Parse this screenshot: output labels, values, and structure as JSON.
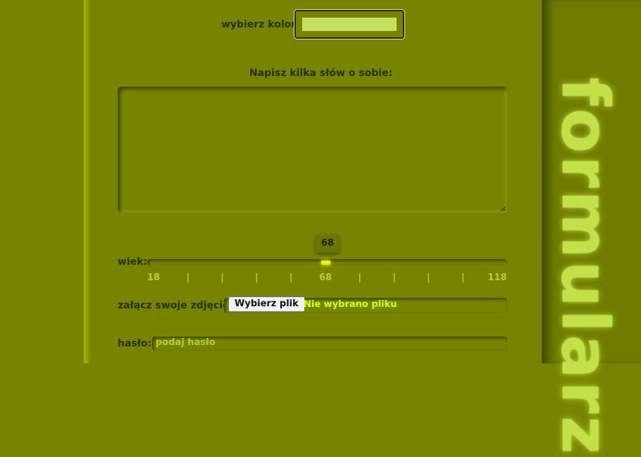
{
  "form": {
    "color": {
      "label": "wybierz kolor:",
      "value": "#c7e063"
    },
    "about": {
      "label": "Napisz kilka słów o sobie:",
      "value": ""
    },
    "age": {
      "label": "wiek:",
      "value": 68,
      "value_text": "68",
      "min": 18,
      "max": 118,
      "tick_labels": [
        "18",
        "|",
        "|",
        "|",
        "|",
        "68",
        "|",
        "|",
        "|",
        "|",
        "118"
      ]
    },
    "photo": {
      "label": "załącz swoje zdjęcie:",
      "button": "Wybierz plik",
      "status": "Nie wybrano pliku"
    },
    "password": {
      "label": "hasło:",
      "placeholder": "podaj hasło"
    }
  },
  "sidebar": {
    "title": "formularz"
  },
  "colors": {
    "background": "#778400",
    "panel": "#6f7c00",
    "title": "#c3df4a",
    "accent": "#e2f800",
    "text": "#2b3000"
  }
}
